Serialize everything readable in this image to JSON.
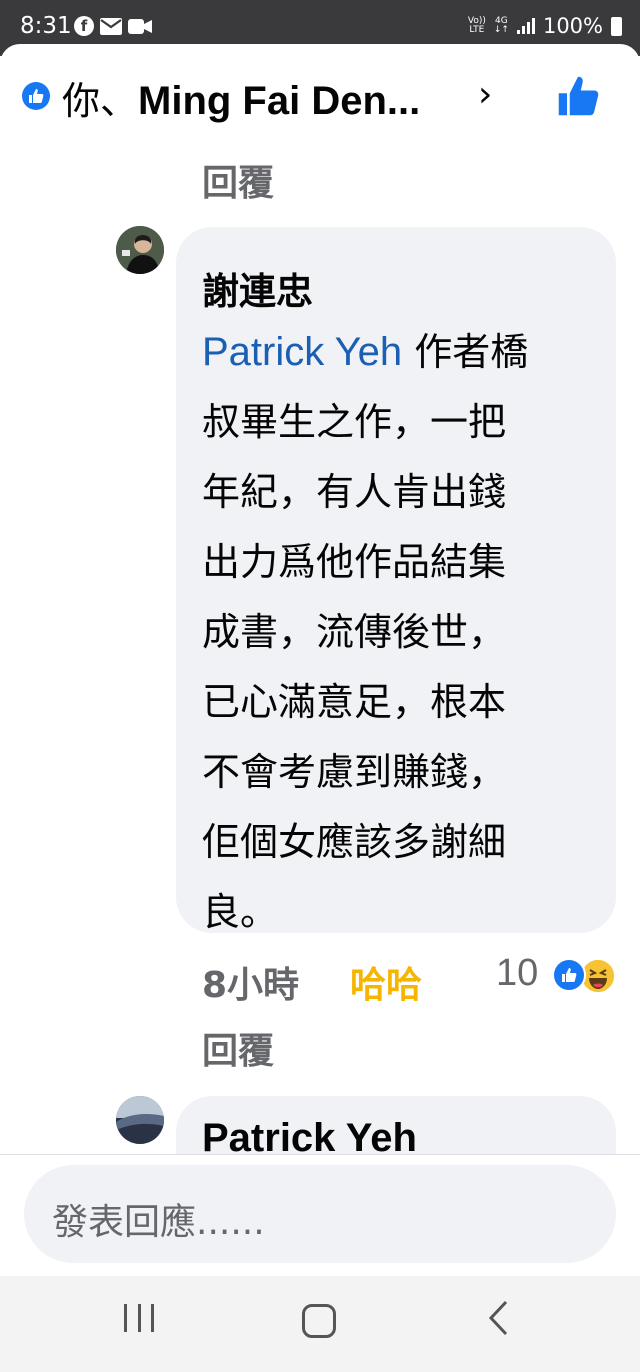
{
  "status_bar": {
    "time": "8:31",
    "network_top": "Vo))",
    "network_bottom": "LTE",
    "signal_type": "4G",
    "battery": "100%"
  },
  "header": {
    "prefix": "你、",
    "name": "Ming Fai Den...",
    "chevron": "›",
    "like_icon": "thumbs-up-icon"
  },
  "thread": {
    "previous_reply_label": "回覆",
    "comment": {
      "author": "謝連忠",
      "mention": "Patrick Yeh",
      "lines": [
        " 作者橋",
        "叔畢生之作，一把",
        "年紀，有人肯出錢",
        "出力爲他作品結集",
        "成書，流傳後世，",
        "已心滿意足，根本",
        "不會考慮到賺錢，",
        "佢個女應該多謝細",
        "良。"
      ],
      "time": "8小時",
      "reaction_label": "哈哈",
      "reaction_count": "10",
      "reply_label": "回覆",
      "reaction_icons": [
        "like-icon",
        "haha-icon"
      ]
    },
    "next_comment": {
      "author": "Patrick Yeh"
    }
  },
  "composer": {
    "placeholder": "發表回應......"
  },
  "colors": {
    "facebook_blue": "#1877f2",
    "mention_blue": "#1a5fb4",
    "haha_yellow": "#f5b500",
    "bubble_gray": "#f0f2f5",
    "meta_gray": "#65676b"
  }
}
